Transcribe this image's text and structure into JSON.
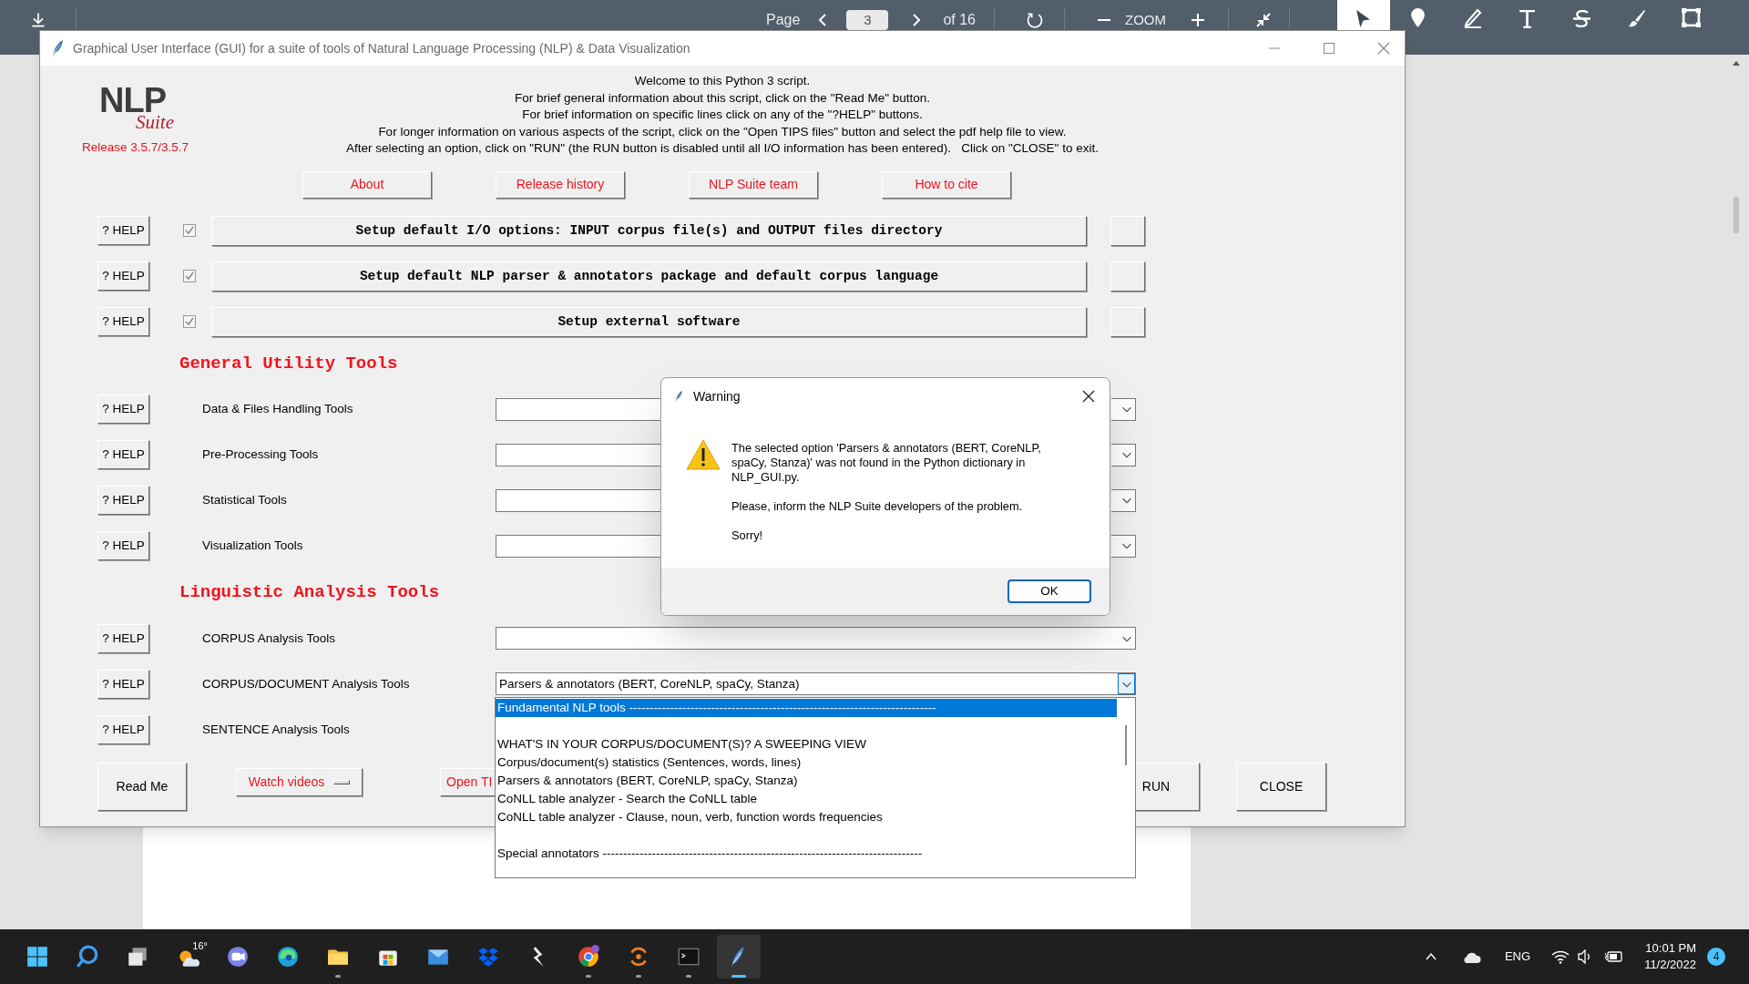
{
  "viewer_toolbar": {
    "page_label": "Page",
    "page_number": "3",
    "page_total": "of 16",
    "zoom_label": "ZOOM",
    "tools": [
      {
        "kind": "pointer",
        "selected": true
      },
      {
        "kind": "pin",
        "selected": false
      },
      {
        "kind": "pen",
        "selected": false
      },
      {
        "kind": "text",
        "selected": false
      },
      {
        "kind": "strike",
        "selected": false
      },
      {
        "kind": "brush",
        "selected": false
      },
      {
        "kind": "crop",
        "selected": false
      }
    ]
  },
  "main_window": {
    "title": "Graphical User Interface (GUI) for a suite of tools of Natural Language Processing (NLP) & Data Visualization",
    "logo": {
      "name": "NLP",
      "sub": "Suite",
      "release": "Release 3.5.7/3.5.7"
    },
    "welcome_lines": [
      "Welcome to this Python 3 script.",
      "For brief general information about this script, click on the \"Read Me\" button.",
      "For brief information on specific lines click on any of the \"?HELP\" buttons.",
      "For longer information on various aspects of the script, click on the \"Open TIPS files\" button and select the pdf help file to view.",
      "After selecting an option, click on \"RUN\" (the RUN button is disabled until all I/O information has been entered).   Click on \"CLOSE\" to exit."
    ],
    "top_buttons": [
      "About",
      "Release history",
      "NLP Suite team",
      "How to cite"
    ],
    "setup_rows": [
      {
        "help": "? HELP",
        "checked": true,
        "label": "Setup default I/O options: INPUT corpus file(s) and OUTPUT files directory"
      },
      {
        "help": "? HELP",
        "checked": true,
        "label": "Setup default NLP parser & annotators package and default corpus language"
      },
      {
        "help": "? HELP",
        "checked": true,
        "label": "Setup external software"
      }
    ],
    "sections": [
      {
        "title": "General Utility Tools",
        "rows": [
          {
            "help": "? HELP",
            "label": "Data & Files Handling Tools",
            "open": false
          },
          {
            "help": "? HELP",
            "label": "Pre-Processing Tools",
            "open": false
          },
          {
            "help": "? HELP",
            "label": "Statistical Tools",
            "open": false
          },
          {
            "help": "? HELP",
            "label": "Visualization Tools",
            "open": false
          }
        ]
      },
      {
        "title": "Linguistic Analysis Tools",
        "rows": [
          {
            "help": "? HELP",
            "label": "CORPUS Analysis Tools",
            "open": false
          },
          {
            "help": "? HELP",
            "label": "CORPUS/DOCUMENT Analysis Tools",
            "value": "Parsers & annotators (BERT, CoreNLP, spaCy, Stanza)",
            "open": true
          },
          {
            "help": "? HELP",
            "label": "SENTENCE Analysis Tools"
          }
        ]
      }
    ],
    "bottom_buttons": [
      {
        "kind": "plain",
        "label": "Read Me"
      },
      {
        "kind": "menu",
        "label": "Watch videos"
      },
      {
        "kind": "link",
        "label": "Open TI"
      },
      {
        "kind": "gap"
      },
      {
        "kind": "plain",
        "label": "RUN"
      },
      {
        "kind": "plain",
        "label": "CLOSE"
      }
    ]
  },
  "dropdown_list": [
    {
      "kind": "option",
      "label": "Fundamental NLP tools ---------------------------------------------------------------------------",
      "selected": true
    },
    {
      "kind": "gap"
    },
    {
      "kind": "option",
      "label": "WHAT'S IN YOUR CORPUS/DOCUMENT(S)? A SWEEPING VIEW",
      "selected": false
    },
    {
      "kind": "option",
      "label": "Corpus/document(s) statistics (Sentences, words, lines)",
      "selected": false
    },
    {
      "kind": "option",
      "label": "Parsers & annotators (BERT, CoreNLP, spaCy, Stanza)",
      "selected": false
    },
    {
      "kind": "option",
      "label": "CoNLL table analyzer - Search the CoNLL table",
      "selected": false
    },
    {
      "kind": "option",
      "label": "CoNLL table analyzer - Clause, noun, verb, function words frequencies",
      "selected": false
    },
    {
      "kind": "gap"
    },
    {
      "kind": "option",
      "label": "Special annotators ------------------------------------------------------------------------------",
      "selected": false
    }
  ],
  "warning_dialog": {
    "title": "Warning",
    "paragraphs": [
      "The selected option 'Parsers & annotators (BERT, CoreNLP, spaCy, Stanza)' was not found in the Python dictionary in NLP_GUI.py.",
      "Please, inform the NLP Suite developers of the problem.",
      "Sorry!"
    ],
    "button": "OK"
  },
  "taskbar": {
    "weather": "16°",
    "apps": [
      {
        "kind": "start",
        "running": false,
        "active": false
      },
      {
        "kind": "search",
        "running": false,
        "active": false
      },
      {
        "kind": "taskview",
        "running": false,
        "active": false
      },
      {
        "kind": "weather",
        "running": false,
        "active": false
      },
      {
        "kind": "chat",
        "running": false,
        "active": false
      },
      {
        "kind": "edge",
        "running": false,
        "active": false
      },
      {
        "kind": "folder",
        "running": true,
        "active": false
      },
      {
        "kind": "store",
        "running": false,
        "active": false
      },
      {
        "kind": "mail",
        "running": false,
        "active": false
      },
      {
        "kind": "box",
        "running": false,
        "active": false
      },
      {
        "kind": "bolt",
        "running": false,
        "active": false
      },
      {
        "kind": "chrome",
        "running": true,
        "active": false
      },
      {
        "kind": "ring",
        "running": true,
        "active": false
      },
      {
        "kind": "terminal",
        "running": true,
        "active": false
      },
      {
        "kind": "feather",
        "running": true,
        "active": true
      }
    ],
    "language": "ENG",
    "time": "10:01 PM",
    "date": "11/2/2022",
    "notifications": "4"
  }
}
